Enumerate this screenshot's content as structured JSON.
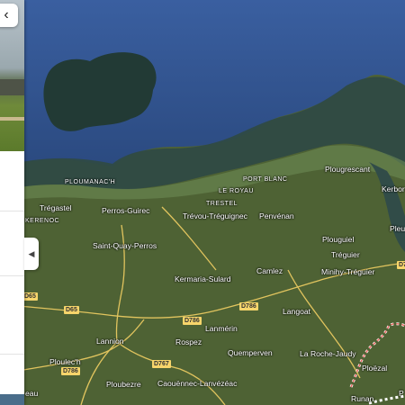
{
  "panel": {
    "back_icon": "close-icon",
    "collapse_icon": "chevron-left-icon"
  },
  "map": {
    "places": [
      {
        "id": "ploumanach",
        "label": "PLOUMANAC'H"
      },
      {
        "id": "kerenoc",
        "label": "KERENOC"
      },
      {
        "id": "tregastel",
        "label": "Trégastel"
      },
      {
        "id": "perros-guirec",
        "label": "Perros-Guirec"
      },
      {
        "id": "saint-quay-perros",
        "label": "Saint-Quay-Perros"
      },
      {
        "id": "le-royau",
        "label": "LE ROYAU"
      },
      {
        "id": "trestel",
        "label": "TRESTEL"
      },
      {
        "id": "port-blanc",
        "label": "PORT BLANC"
      },
      {
        "id": "trevou-treguignec",
        "label": "Trévou-Tréguignec"
      },
      {
        "id": "penvenan",
        "label": "Penvénan"
      },
      {
        "id": "plougrescant",
        "label": "Plougrescant"
      },
      {
        "id": "kerbors",
        "label": "Kerbor"
      },
      {
        "id": "plouguiel",
        "label": "Plouguiel"
      },
      {
        "id": "pleubian",
        "label": "Pleu"
      },
      {
        "id": "treguier",
        "label": "Tréguier"
      },
      {
        "id": "minihy-treguier",
        "label": "Minihy-Tréguier"
      },
      {
        "id": "camlez",
        "label": "Camlez"
      },
      {
        "id": "kermaria-sulard",
        "label": "Kermaria-Sulard"
      },
      {
        "id": "langoat",
        "label": "Langoat"
      },
      {
        "id": "lanmerin",
        "label": "Lanmérin"
      },
      {
        "id": "lannion",
        "label": "Lannion"
      },
      {
        "id": "rospez",
        "label": "Rospez"
      },
      {
        "id": "quemperven",
        "label": "Quemperven"
      },
      {
        "id": "la-roche-jaudy",
        "label": "La Roche-Jaudy"
      },
      {
        "id": "ploezal",
        "label": "Ploëzal"
      },
      {
        "id": "ploulech",
        "label": "Ploulec'h"
      },
      {
        "id": "ploubezre",
        "label": "Ploubezre"
      },
      {
        "id": "caouennec-lanvezeac",
        "label": "Caouënnec-Lanvézéac"
      },
      {
        "id": "runan",
        "label": "Runan"
      },
      {
        "id": "beg",
        "label": "eau"
      },
      {
        "id": "pl",
        "label": "P"
      }
    ],
    "roads": [
      {
        "id": "d65-a",
        "label": "D65"
      },
      {
        "id": "d65-b",
        "label": "D65"
      },
      {
        "id": "d786-a",
        "label": "D786"
      },
      {
        "id": "d786-b",
        "label": "D786"
      },
      {
        "id": "d786-c",
        "label": "D786"
      },
      {
        "id": "d767",
        "label": "D767"
      },
      {
        "id": "d7",
        "label": "D7"
      }
    ],
    "colors": {
      "sea": "#2e4f8a",
      "land": "#4f6335",
      "road": "#f7d56b",
      "boundary": "#e8655f"
    }
  }
}
